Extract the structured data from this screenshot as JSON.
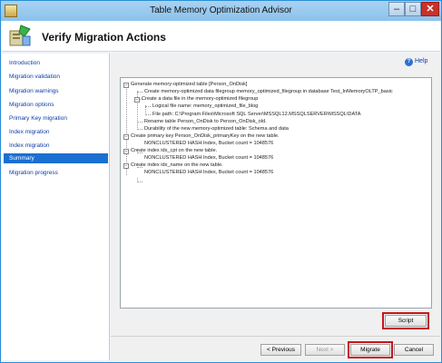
{
  "window": {
    "title": "Table Memory Optimization Advisor"
  },
  "header": {
    "title": "Verify Migration Actions"
  },
  "sidebar": {
    "items": [
      {
        "label": "Introduction",
        "active": false
      },
      {
        "label": "Migration validation",
        "active": false
      },
      {
        "label": "Migration warnings",
        "active": false
      },
      {
        "label": "Migration options",
        "active": false
      },
      {
        "label": "Primary Key migration",
        "active": false
      },
      {
        "label": "Index migration",
        "active": false
      },
      {
        "label": "Index migration",
        "active": false
      },
      {
        "label": "Summary",
        "active": true
      },
      {
        "label": "Migration progress",
        "active": false
      }
    ]
  },
  "help": {
    "label": "Help"
  },
  "tree": {
    "lines": [
      "Generate memory-optimized table [Person_OnDisk]",
      "Create memory-optimized data filegroup memory_optimized_filegroup in database Test_InMemoryOLTP_basic",
      "Create a data file in the memory-optimized filegroup",
      "Logical file name: memory_optimized_file_blog",
      "File path: C:\\Program Files\\Microsoft SQL Server\\MSSQL12.MSSQLSERVER\\MSSQL\\DATA",
      "Rename table Person_OnDisk to Person_OnDisk_old.",
      "Durability of the new memory-optimized table: Schema and data",
      "Create primary key Person_OnDisk_primaryKey on the new table.",
      "NONCLUSTERED HASH Index, Bucket count = 1048576",
      "Create index idx_cpt on the new table.",
      "NONCLUSTERED HASH Index, Bucket count = 1048576",
      "Create index idx_name on the new table.",
      "NONCLUSTERED HASH Index, Bucket count = 1048576"
    ]
  },
  "buttons": {
    "script": "Script",
    "previous": "< Previous",
    "next": "Next >",
    "migrate": "Migrate",
    "cancel": "Cancel"
  },
  "colors": {
    "accent": "#1b6fd1",
    "highlight": "#c8151b",
    "link": "#0b3da8"
  },
  "icons": {
    "app": "app-icon",
    "header": "wizard-icon",
    "help": "help-icon"
  }
}
